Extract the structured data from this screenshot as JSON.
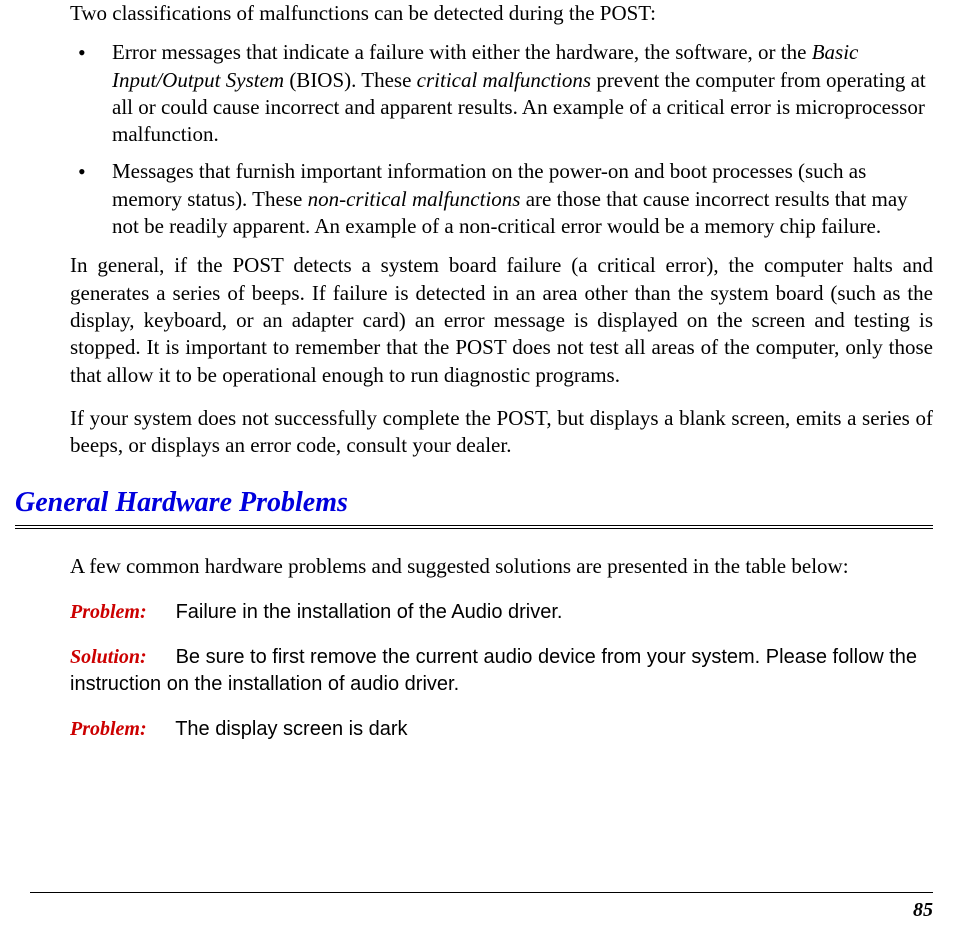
{
  "intro": "Two classifications of malfunctions can be detected during the POST:",
  "bullets": [
    {
      "pre": "Error messages that indicate a failure with either the hardware, the software, or the ",
      "italic1": "Basic Input/Output System",
      "mid1": " (BIOS). These ",
      "italic2": "critical malfunctions",
      "post": " prevent the computer from operating at all or could cause incorrect and apparent results. An example of a critical error is microprocessor malfunction."
    },
    {
      "pre": "Messages that furnish important information on the power-on and boot processes (such as memory status). These ",
      "italic1": "non-critical malfunctions",
      "post": " are those that cause incorrect results that may not be readily apparent. An example of a non-critical error would be a memory chip failure."
    }
  ],
  "para2": "In general, if the POST detects a system board failure (a critical error), the computer halts and generates a series of beeps. If failure is detected in an area other than the system board (such as the display, keyboard, or an adapter card) an error message is displayed on the screen and testing is stopped. It is important to remember that the POST does not test all areas of the computer, only those that allow it to be operational enough to run diagnostic programs.",
  "para3": "If your system does not successfully complete the POST, but displays a blank screen, emits a series of beeps, or displays an error code, consult your dealer.",
  "heading": "General Hardware Problems",
  "intro2": "A few common hardware problems and suggested solutions are presented in the table below:",
  "labels": {
    "problem": "Problem:",
    "solution": "Solution:"
  },
  "items": [
    {
      "problem": "Failure in the installation of the Audio driver.",
      "solution": "Be sure to first remove the current audio device from your system. Please follow the instruction on the installation of audio driver."
    },
    {
      "problem": "The display screen is dark"
    }
  ],
  "pageNumber": "85"
}
